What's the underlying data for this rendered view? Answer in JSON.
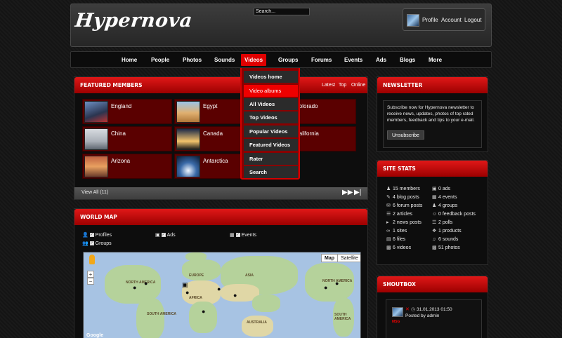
{
  "header": {
    "logo": "Hypernova",
    "search_value": "Search...",
    "user_links": [
      "Profile",
      "Account",
      "Logout"
    ]
  },
  "nav": {
    "items": [
      "Home",
      "People",
      "Photos",
      "Sounds",
      "Videos",
      "Groups",
      "Forums",
      "Events",
      "Ads",
      "Blogs",
      "More"
    ],
    "active": "Videos"
  },
  "videos_menu": {
    "items": [
      "Videos home",
      "Video albums",
      "All Videos",
      "Top Videos",
      "Popular Videos",
      "Featured Videos",
      "Rater",
      "Search"
    ],
    "hovered": "Video albums"
  },
  "featured": {
    "title": "FEATURED MEMBERS",
    "tabs": [
      "Latest",
      "Top",
      "Online"
    ],
    "members": [
      "England",
      "Egypt",
      "Colorado",
      "China",
      "Canada",
      "California",
      "Arizona",
      "Antarctica"
    ],
    "view_all": "View All (11)"
  },
  "worldmap": {
    "title": "WORLD MAP",
    "legend": [
      "Profiles",
      "Ads",
      "Events",
      "Groups"
    ],
    "map_type_buttons": [
      "Map",
      "Satellite"
    ],
    "labels": [
      "NORTH AMERICA",
      "EUROPE",
      "ASIA",
      "AFRICA",
      "SOUTH AMERICA",
      "AUSTRALIA",
      "NORTH AMERICA",
      "SOUTH AMERICA",
      "Google"
    ]
  },
  "newsletter": {
    "title": "NEWSLETTER",
    "text": "Subscribe now for Hypernova newsletter to receive news, updates, photos of top rated members, feedback and tips to your e-mail.",
    "button": "Unsubscribe"
  },
  "stats": {
    "title": "SITE STATS",
    "left": [
      "15 members",
      "4 blog posts",
      "6 forum posts",
      "2 articles",
      "2 news posts",
      "1 sites",
      "6 files",
      "6 videos"
    ],
    "right": [
      "0 ads",
      "4 events",
      "4 groups",
      "0 feedback posts",
      "2 polls",
      "1 products",
      "6 sounds",
      "51 photos"
    ]
  },
  "shoutbox": {
    "title": "SHOUTBOX",
    "date": "31.01.2013 01:50",
    "posted_by": "Posted by admin",
    "tag": "MSG"
  }
}
